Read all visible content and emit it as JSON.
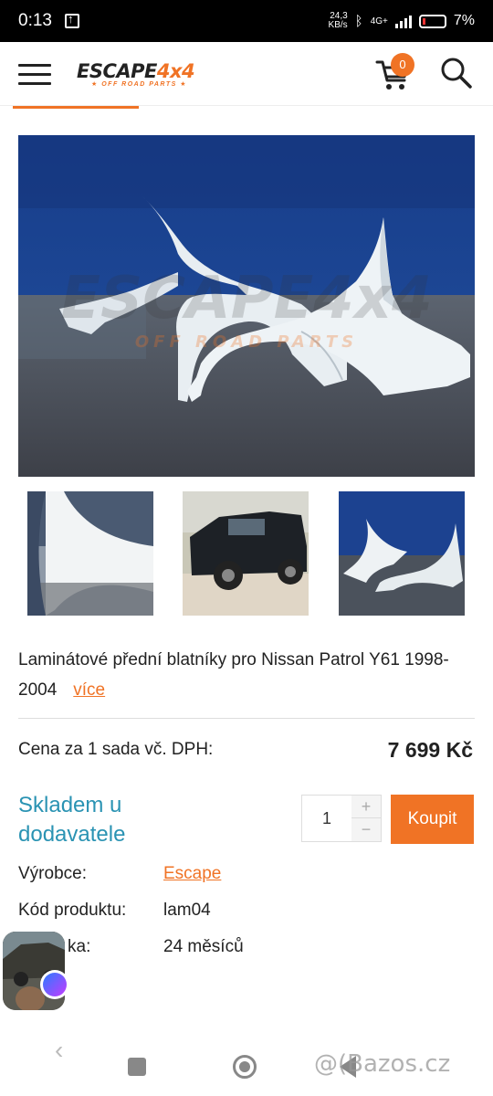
{
  "status_bar": {
    "time": "0:13",
    "speed_value": "24,3",
    "speed_unit": "KB/s",
    "network": "4G+",
    "battery": "7%"
  },
  "header": {
    "logo_main": "ESCAPE",
    "logo_accent": "4x4",
    "logo_sub": "★ OFF ROAD PARTS ★",
    "cart_count": "0"
  },
  "product": {
    "description": "Laminátové přední blatníky pro Nissan Patrol Y61 1998-2004",
    "more_link": "více",
    "price_label": "Cena za 1 sada vč. DPH:",
    "price_value": "7 699 Kč",
    "stock_status": "Skladem u dodavatele",
    "quantity": "1",
    "quantity_plus": "+",
    "quantity_minus": "−",
    "buy_label": "Koupit",
    "specs": [
      {
        "label": "Výrobce:",
        "value": "Escape"
      },
      {
        "label": "Kód produktu:",
        "value": "lam04"
      },
      {
        "label": "ka:",
        "value": "24 měsíců"
      }
    ]
  },
  "watermark": "@(Bazos.cz",
  "colors": {
    "accent": "#f07325",
    "stock": "#2a93b3"
  }
}
